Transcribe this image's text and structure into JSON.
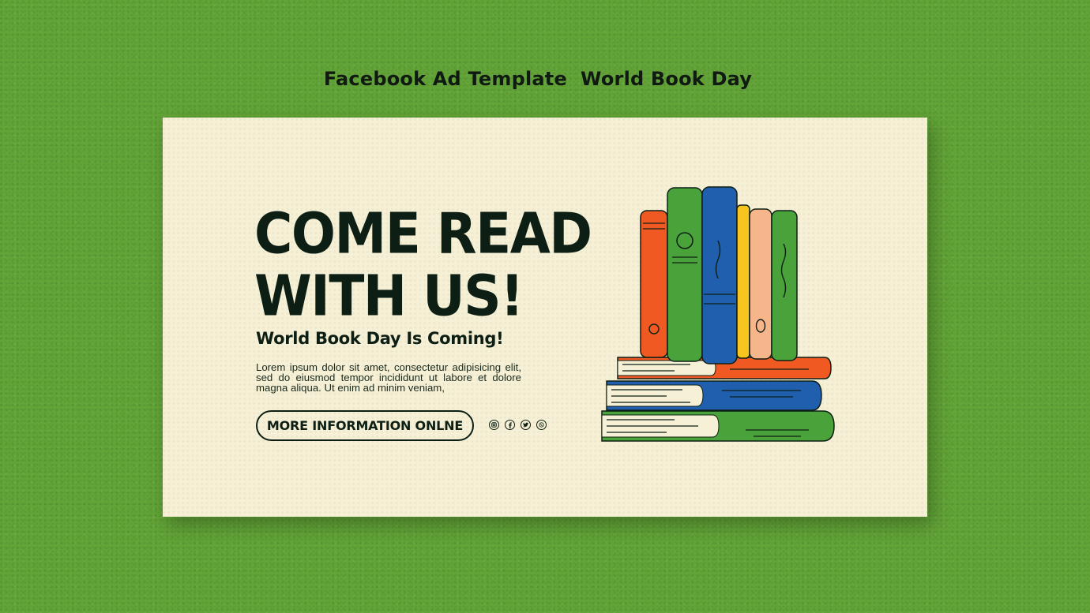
{
  "page": {
    "heading": "Facebook Ad Template  World Book Day"
  },
  "ad": {
    "headline_line1": "COME READ",
    "headline_line2": "WITH US!",
    "subheadline": "World Book Day Is Coming!",
    "body": "Lorem ipsum dolor sit amet, consectetur adipisicing elit, sed do eiusmod tempor incididunt ut labore et dolore magna aliqua. Ut enim ad minim veniam,",
    "cta_label": "MORE INFORMATION ONLNE",
    "social_icons": [
      "instagram-icon",
      "facebook-icon",
      "twitter-icon",
      "whatsapp-icon"
    ]
  },
  "colors": {
    "background": "#62a437",
    "card": "#f5f0d6",
    "text": "#0d1f14",
    "book_orange": "#f05a22",
    "book_green": "#4aa23a",
    "book_blue": "#1f5fae",
    "book_yellow": "#f7c51e",
    "book_peach": "#f6b58a"
  }
}
